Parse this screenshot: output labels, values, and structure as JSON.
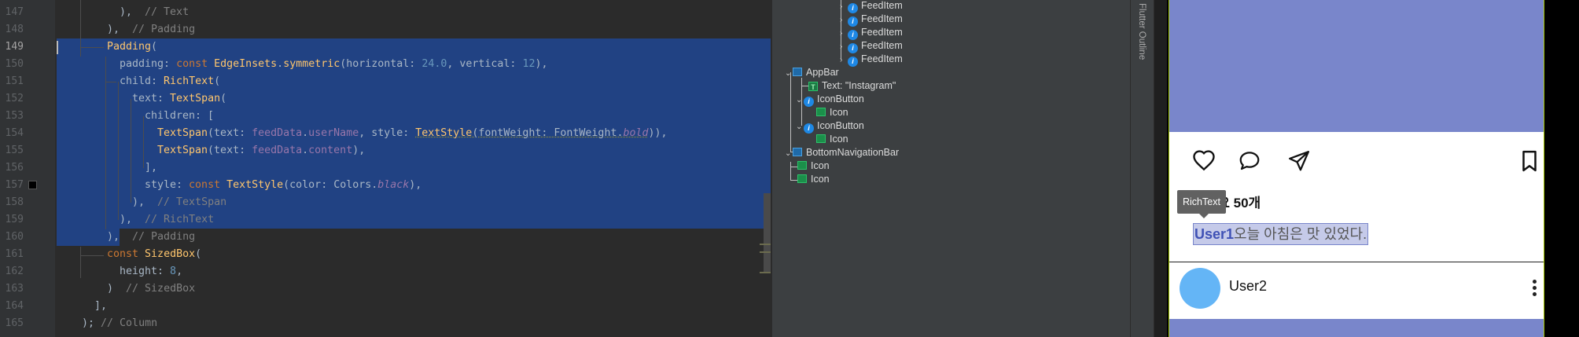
{
  "editor": {
    "line_numbers": [
      "147",
      "148",
      "149",
      "150",
      "151",
      "152",
      "153",
      "154",
      "155",
      "156",
      "157",
      "158",
      "159",
      "160",
      "161",
      "162",
      "163",
      "164",
      "165"
    ],
    "lines": {
      "l147": {
        "close": "),",
        "comment": "// Text"
      },
      "l148": {
        "close": "),",
        "comment": "// Padding"
      },
      "l149": {
        "cls": "Padding",
        "rest": "("
      },
      "l150": {
        "prop": "padding: ",
        "kw": "const ",
        "cls": "EdgeInsets",
        "dot": ".",
        "fn": "symmetric",
        "p1": "(horizontal: ",
        "n1": "24.0",
        "p2": ", vertical: ",
        "n2": "12",
        "p3": "),"
      },
      "l151": {
        "prop": "child: ",
        "cls": "RichText",
        "rest": "("
      },
      "l152": {
        "prop": "text: ",
        "cls": "TextSpan",
        "rest": "("
      },
      "l153": {
        "prop": "children: ["
      },
      "l154": {
        "cls": "TextSpan",
        "p1": "(text: ",
        "par": "feedData",
        "p2": ".",
        "par2": "userName",
        "p3": ", style: ",
        "cls2": "TextStyle",
        "p4": "(fontWeight: FontWeight.",
        "it": "bold",
        "p5": ")),"
      },
      "l155": {
        "cls": "TextSpan",
        "p1": "(text: ",
        "par": "feedData",
        "p2": ".",
        "par2": "content",
        "p3": "),"
      },
      "l156": {
        "prop": "],"
      },
      "l157": {
        "prop": "style: ",
        "kw": "const ",
        "cls": "TextStyle",
        "p1": "(color: Colors.",
        "it": "black",
        "p2": "),"
      },
      "l158": {
        "close": "),",
        "comment": "// TextSpan"
      },
      "l159": {
        "close": "),",
        "comment": "// RichText"
      },
      "l160": {
        "close": "),",
        "comment": "// Padding"
      },
      "l161": {
        "kw": "const ",
        "cls": "SizedBox",
        "rest": "("
      },
      "l162": {
        "prop": "height: ",
        "num": "8",
        "rest": ","
      },
      "l163": {
        "close": ")",
        "comment": "// SizedBox"
      },
      "l164": {
        "close": "],"
      },
      "l165": {
        "close": ");",
        "comment": "// Column"
      }
    }
  },
  "outline": {
    "feed_items": [
      "FeedItem",
      "FeedItem",
      "FeedItem",
      "FeedItem",
      "FeedItem"
    ],
    "appbar": "AppBar",
    "appbar_text": "Text: \"Instagram\"",
    "icon_button": "IconButton",
    "icon": "Icon",
    "bottom_nav": "BottomNavigationBar",
    "sidebar_label": "Flutter Outline"
  },
  "phone": {
    "likes": "좋아요 50개",
    "tooltip": "RichText",
    "rich_user": "User1",
    "rich_content": "오늘 아침은 맛 있었다.",
    "next_user": "User2"
  },
  "colors": {
    "selection": "#214283",
    "image_placeholder": "#7986cb",
    "avatar": "#64b5f6",
    "widget_icon": "#1e88e5"
  },
  "icons": [
    "heart-icon",
    "comment-icon",
    "send-icon",
    "bookmark-icon",
    "more-vert-icon"
  ]
}
